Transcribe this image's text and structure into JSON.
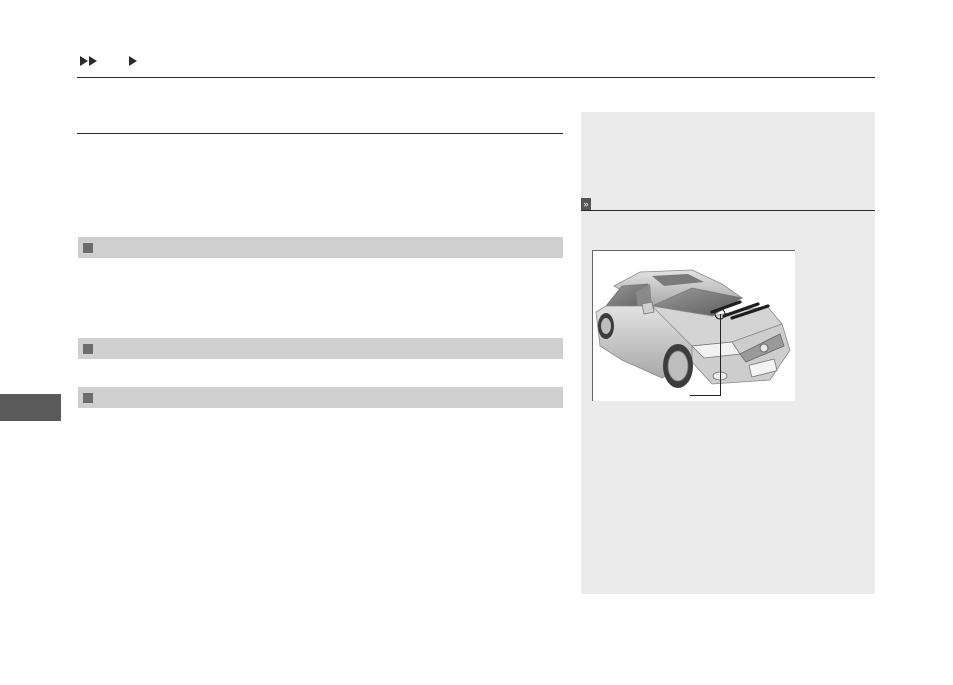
{
  "breadcrumb": {
    "level1": "",
    "level2": ""
  },
  "section": {
    "intro_text": ""
  },
  "bars": [
    {
      "label": ""
    },
    {
      "label": ""
    },
    {
      "label": ""
    }
  ],
  "sidebar_panel": {
    "note_text": "",
    "reference_text": "",
    "figure_callout": ""
  },
  "icons": {
    "breadcrumb_double": "double-triangle-right-icon",
    "breadcrumb_single": "triangle-right-icon",
    "reference": "double-chevron-right-icon",
    "bar_marker": "square-marker-icon"
  },
  "colors": {
    "bar_fill": "#cfcfcf",
    "panel_fill": "#ebebeb",
    "side_tab": "#5a5a5a"
  }
}
